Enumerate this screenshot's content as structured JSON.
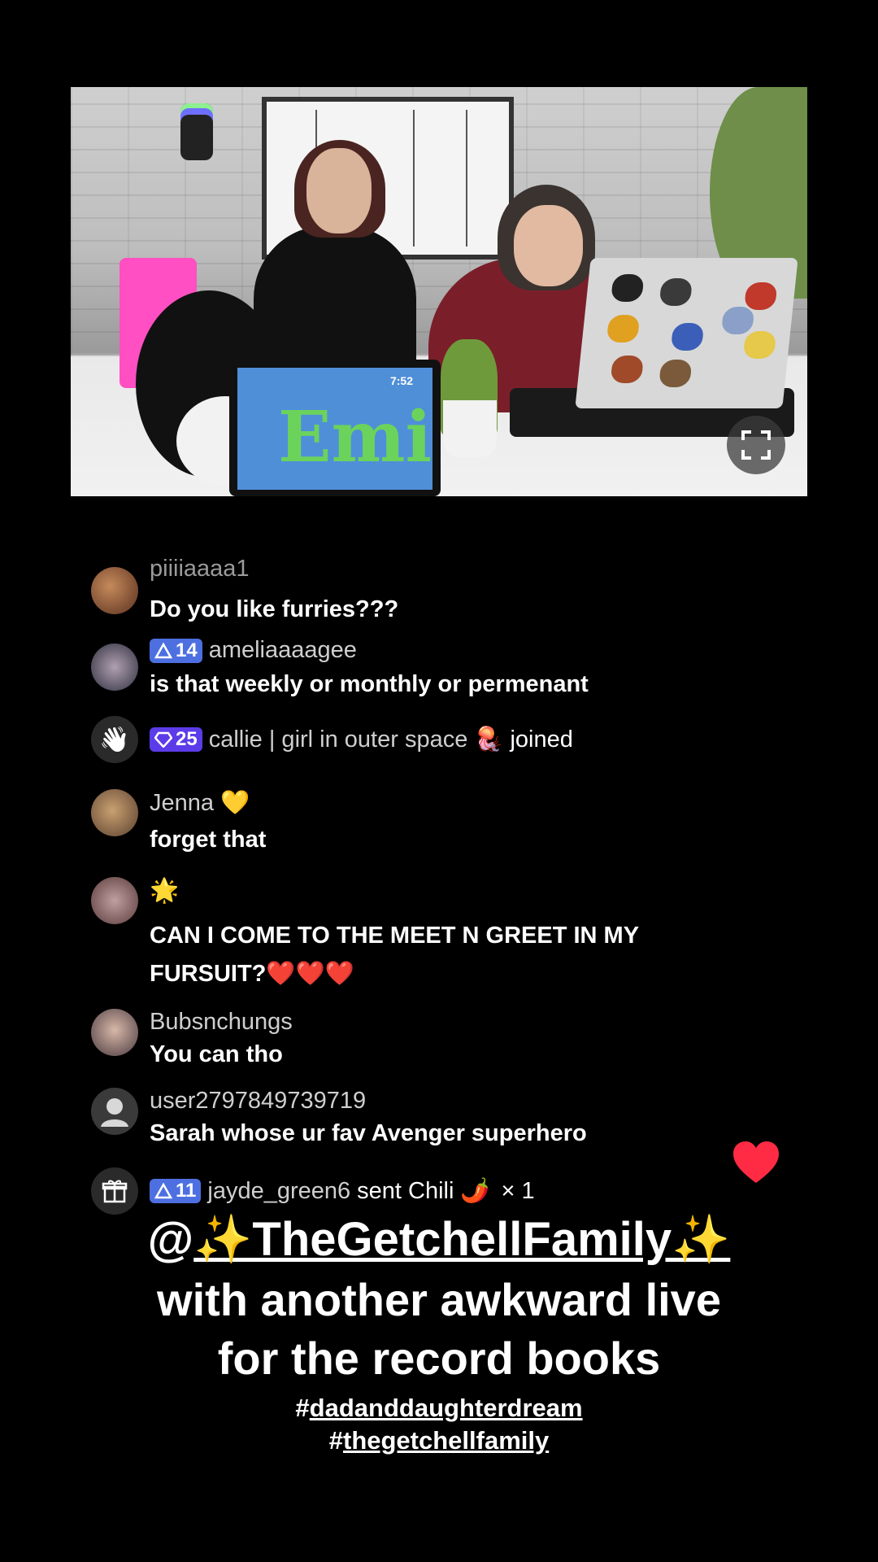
{
  "video": {
    "tablet_text": "Emi",
    "tablet_clock": "7:52"
  },
  "chat": [
    {
      "user": "piiiiaaaa1",
      "text": "Do you like furries???"
    },
    {
      "badge": "14",
      "user": "ameliaaaagee",
      "text": "is that weekly or monthly or permenant"
    },
    {
      "badge": "25",
      "user": "callie | girl in outer space",
      "user_emoji": "🪼",
      "action": "joined"
    },
    {
      "user": "Jenna",
      "user_emoji": "💛",
      "text": "forget that"
    },
    {
      "user_emoji": "🌟",
      "text_line1": "CAN I COME TO THE MEET N GREET IN MY",
      "text_line2": "FURSUIT?❤️❤️❤️"
    },
    {
      "user": "Bubsnchungs",
      "text": "You can tho"
    },
    {
      "user": "user2797849739719",
      "text": "Sarah whose ur fav Avenger superhero"
    },
    {
      "badge": "11",
      "user": "jayde_green6",
      "action": "sent Chili",
      "gift_emoji": "🌶️",
      "count": "× 1"
    }
  ],
  "caption": {
    "at": "@",
    "handle": "✨TheGetchellFamily✨",
    "line2": "with another awkward live",
    "line3": "for the record books",
    "hash": "#",
    "tag1": "dadanddaughterdream",
    "tag2": "thegetchellfamily"
  },
  "colors": {
    "badge_blue": "#4d6fe0",
    "badge_purple": "#5b3ce8",
    "heart": "#ff2b44"
  }
}
